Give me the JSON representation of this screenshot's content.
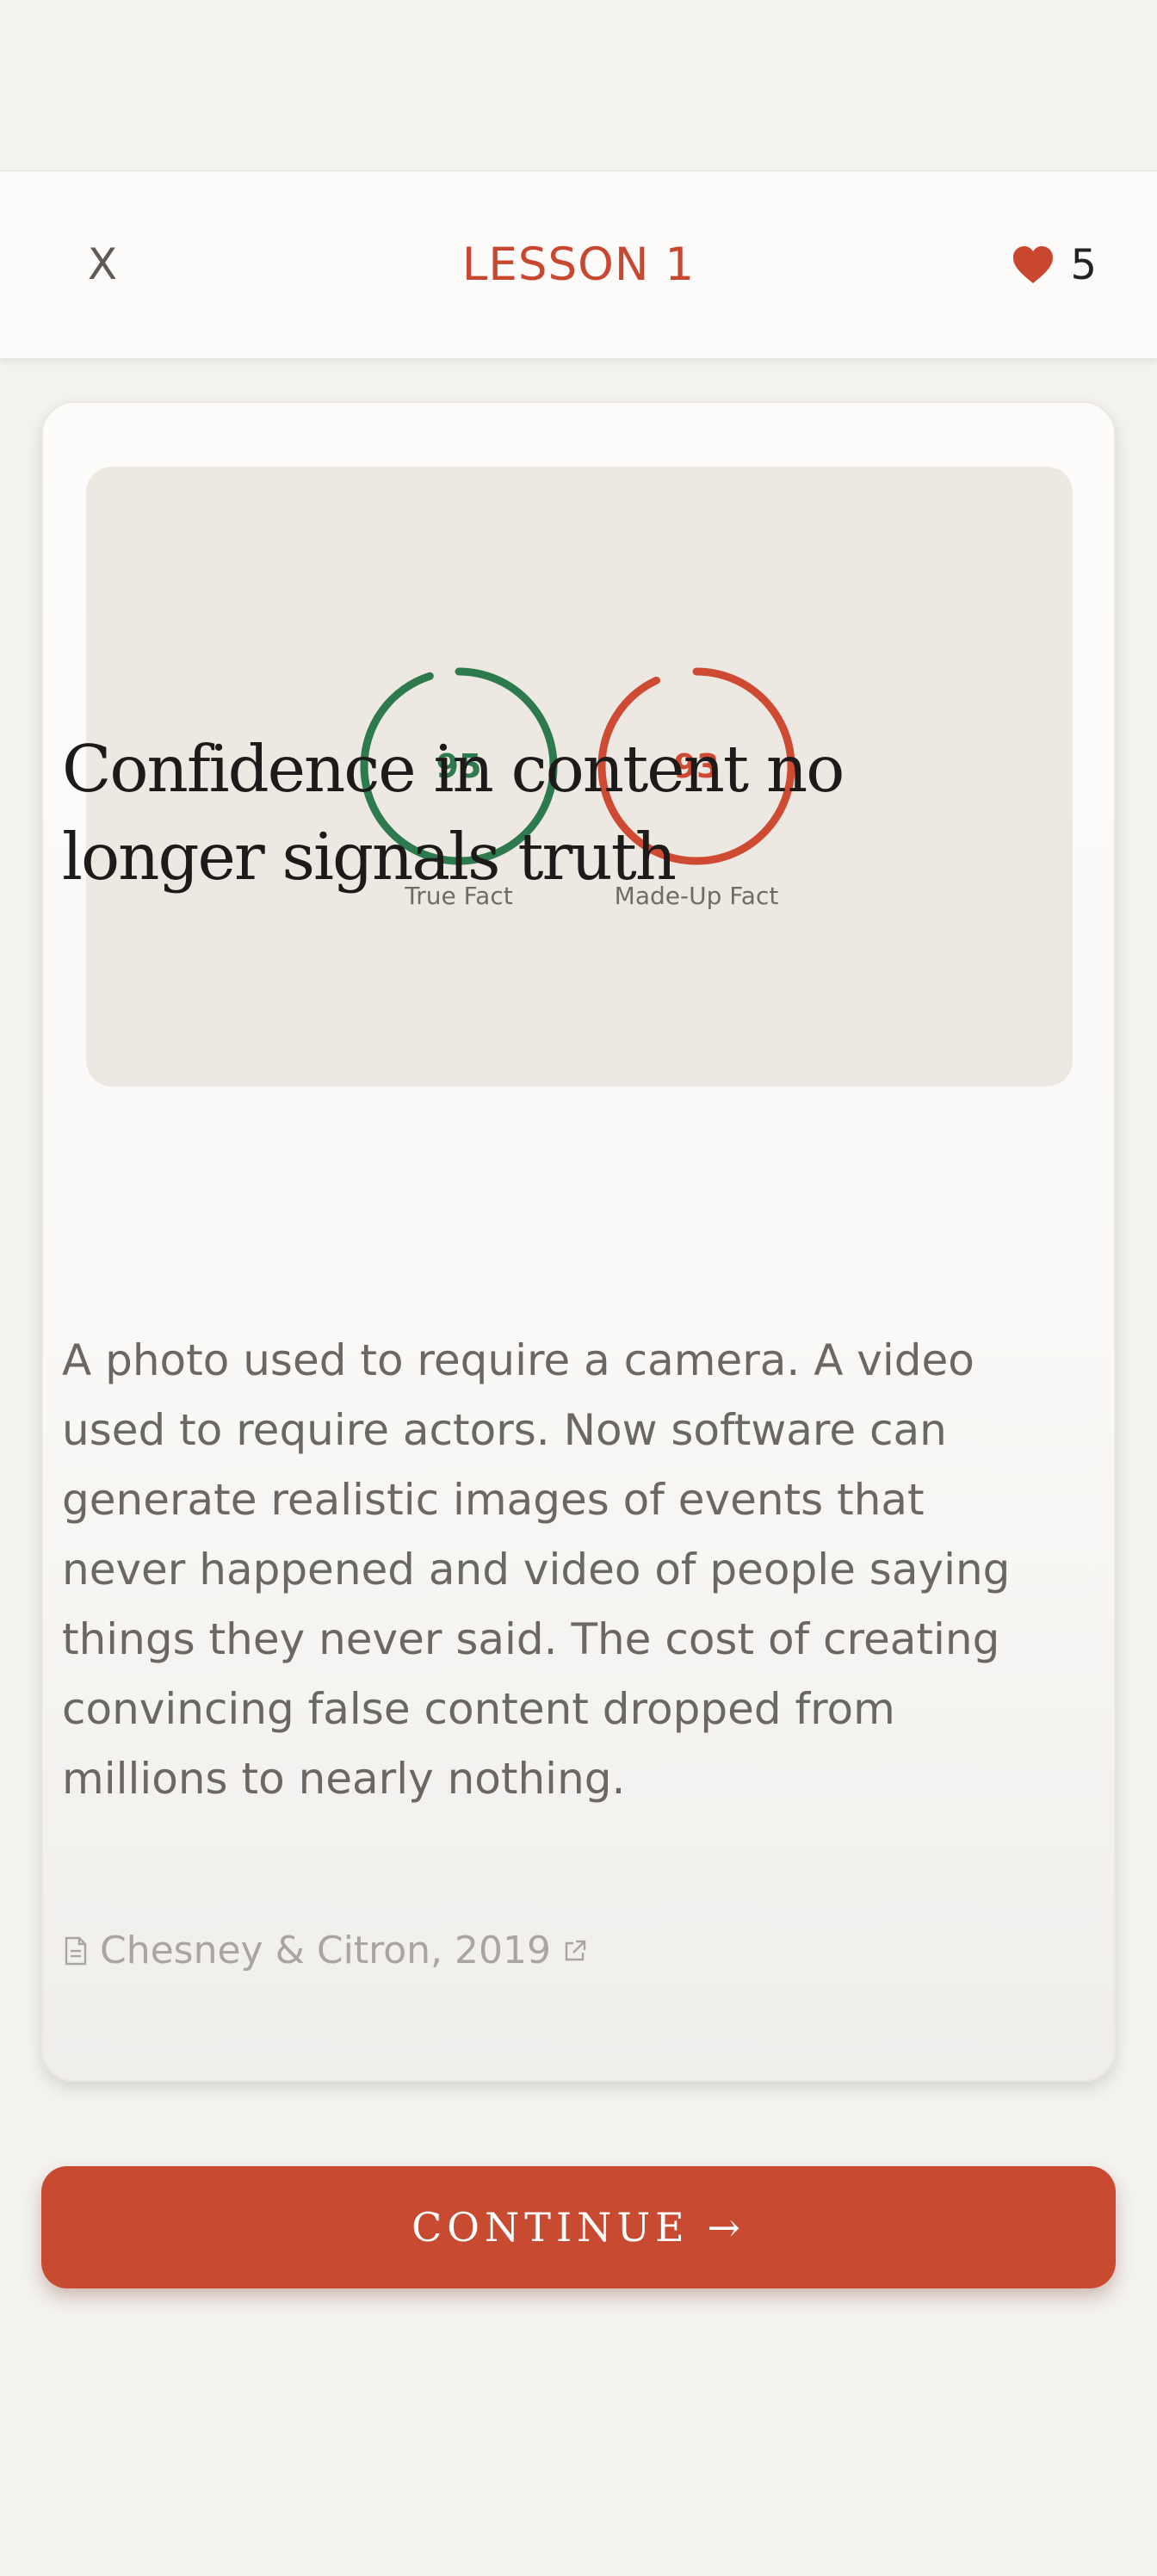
{
  "header": {
    "close_label": "X",
    "title": "LESSON 1",
    "lives_count": "5",
    "heart_color": "#c9472f"
  },
  "illustration": {
    "gauges": [
      {
        "value": "95",
        "label": "True Fact",
        "color": "#2e7a4f"
      },
      {
        "value": "93",
        "label": "Made-Up Fact",
        "color": "#cf4a32"
      }
    ]
  },
  "card": {
    "heading": "Confidence in content no longer signals truth",
    "body": "A photo used to require a camera. A video used to require actors. Now software can generate realistic images of events that never happened and video of people saying things they never said. The cost of creating convincing false content dropped from millions to nearly nothing.",
    "citation": "Chesney & Citron, 2019",
    "citation_icon": "document-icon",
    "citation_link_icon": "external-link-icon"
  },
  "continue_label": "CONTINUE →",
  "colors": {
    "accent": "#c84a30",
    "background": "#f3f2ef",
    "true_green": "#2e7a4f"
  }
}
